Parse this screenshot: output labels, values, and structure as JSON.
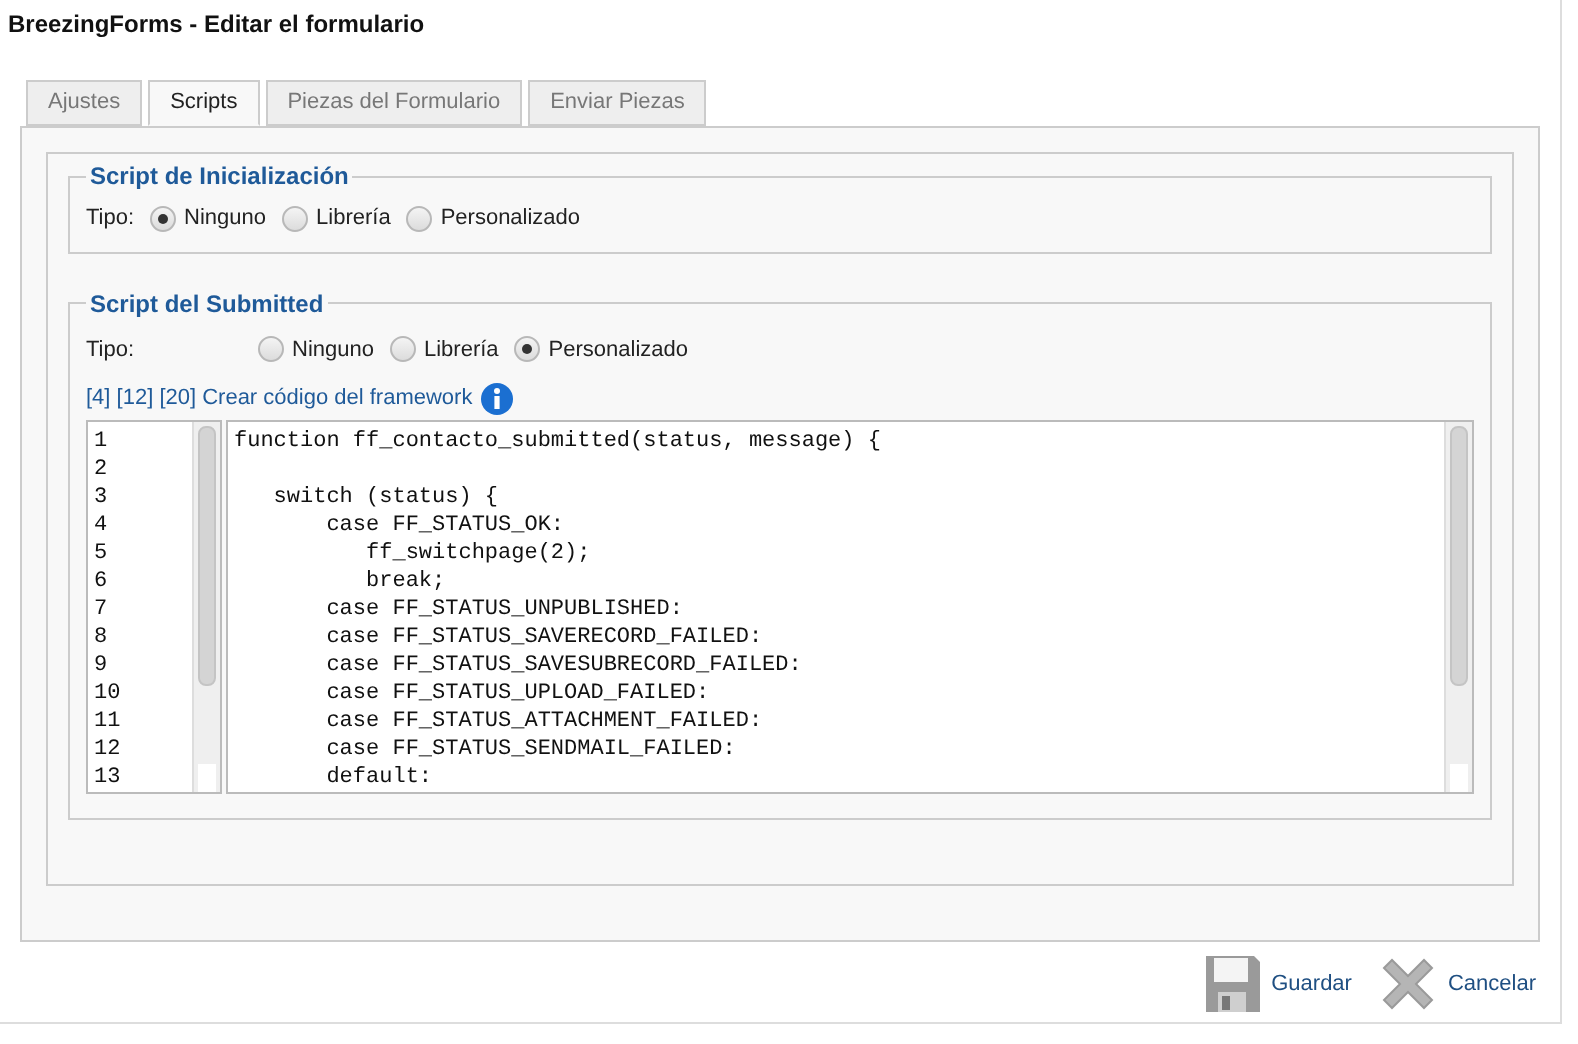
{
  "window": {
    "title": "BreezingForms - Editar el formulario"
  },
  "tabs": [
    {
      "label": "Ajustes",
      "selected": false
    },
    {
      "label": "Scripts",
      "selected": true
    },
    {
      "label": "Piezas del Formulario",
      "selected": false
    },
    {
      "label": "Enviar Piezas",
      "selected": false
    }
  ],
  "sections": [
    {
      "legend": "Script de Inicialización",
      "type_label": "Tipo:",
      "options": [
        {
          "label": "Ninguno",
          "selected": true
        },
        {
          "label": "Librería",
          "selected": false
        },
        {
          "label": "Personalizado",
          "selected": false
        }
      ]
    },
    {
      "legend": "Script del Submitted",
      "type_label": "Tipo:",
      "options": [
        {
          "label": "Ninguno",
          "selected": false
        },
        {
          "label": "Librería",
          "selected": false
        },
        {
          "label": "Personalizado",
          "selected": true
        }
      ],
      "framework_link": "[4] [12] [20] Crear código del framework",
      "editor": {
        "line_numbers": [
          "1",
          "2",
          "3",
          "4",
          "5",
          "6",
          "7",
          "8",
          "9",
          "10",
          "11",
          "12",
          "13"
        ],
        "code": "function ff_contacto_submitted(status, message) {\n\n   switch (status) {\n       case FF_STATUS_OK:\n          ff_switchpage(2);\n          break;\n       case FF_STATUS_UNPUBLISHED:\n       case FF_STATUS_SAVERECORD_FAILED:\n       case FF_STATUS_SAVESUBRECORD_FAILED:\n       case FF_STATUS_UPLOAD_FAILED:\n       case FF_STATUS_ATTACHMENT_FAILED:\n       case FF_STATUS_SENDMAIL_FAILED:\n       default:"
      }
    }
  ],
  "buttons": [
    {
      "kind": "save",
      "label": "Guardar"
    },
    {
      "kind": "cancel",
      "label": "Cancelar"
    }
  ]
}
